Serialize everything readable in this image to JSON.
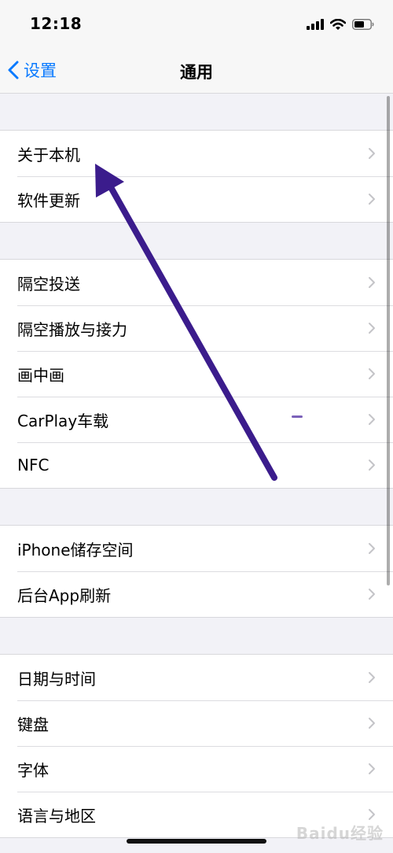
{
  "status_bar": {
    "time": "12:18",
    "icons": [
      "cellular-signal-icon",
      "wifi-icon",
      "battery-icon"
    ]
  },
  "nav": {
    "back_label": "设置",
    "title": "通用",
    "accent_color": "#0a7aff"
  },
  "groups": [
    {
      "items": [
        {
          "label": "关于本机"
        },
        {
          "label": "软件更新"
        }
      ]
    },
    {
      "items": [
        {
          "label": "隔空投送"
        },
        {
          "label": "隔空播放与接力"
        },
        {
          "label": "画中画"
        },
        {
          "label": "CarPlay车载"
        },
        {
          "label": "NFC"
        }
      ]
    },
    {
      "items": [
        {
          "label": "iPhone储存空间"
        },
        {
          "label": "后台App刷新"
        }
      ]
    },
    {
      "items": [
        {
          "label": "日期与时间"
        },
        {
          "label": "键盘"
        },
        {
          "label": "字体"
        },
        {
          "label": "语言与地区"
        }
      ]
    }
  ],
  "annotation": {
    "color": "#3b1c8c",
    "target_item": "关于本机"
  },
  "watermark": {
    "text": "Baidu经验"
  }
}
